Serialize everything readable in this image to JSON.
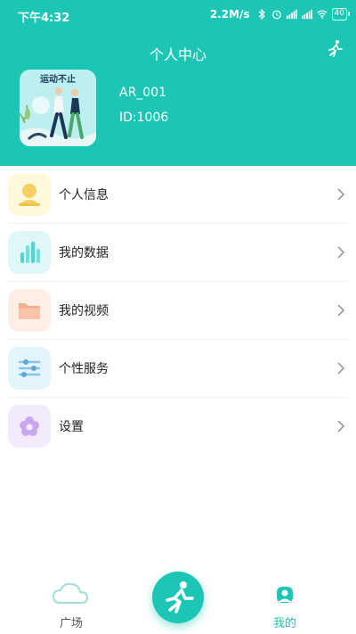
{
  "status_bar": {
    "time": "下午4:32",
    "speed": "2.2M/s",
    "battery": "40"
  },
  "header": {
    "title": "个人中心",
    "avatar_text": "运动不止"
  },
  "user": {
    "name": "AR_001",
    "id": "ID:1006"
  },
  "menu": {
    "items": [
      {
        "label": "个人信息",
        "icon": "profile-icon"
      },
      {
        "label": "我的数据",
        "icon": "bar-chart-icon"
      },
      {
        "label": "我的视频",
        "icon": "folder-video-icon"
      },
      {
        "label": "个性服务",
        "icon": "sliders-icon"
      },
      {
        "label": "设置",
        "icon": "flower-settings-icon"
      }
    ]
  },
  "bottom_nav": {
    "plaza": "广场",
    "mine": "我的",
    "active": "mine"
  },
  "colors": {
    "accent": "#1dc6b4"
  }
}
